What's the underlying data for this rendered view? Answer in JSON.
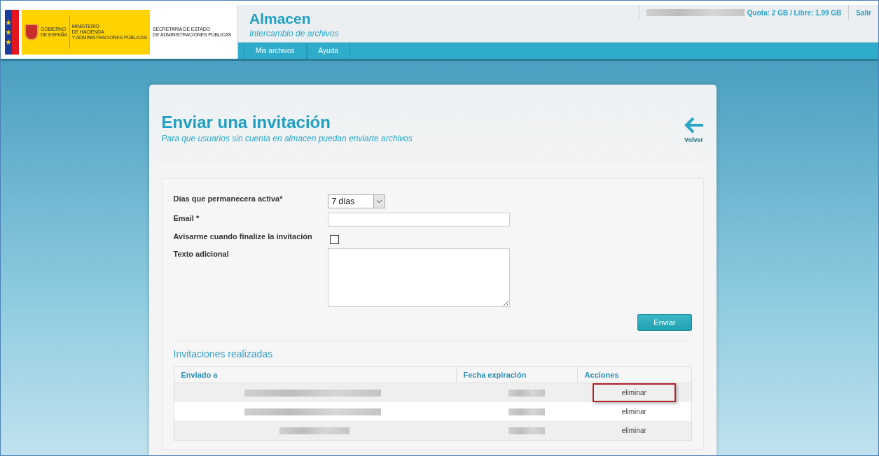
{
  "logo": {
    "lines_left": [
      "GOBIERNO",
      "DE ESPAÑA"
    ],
    "lines_mid": [
      "MINISTERIO",
      "DE HACIENDA",
      "Y ADMINISTRACIONES PÚBLICAS"
    ],
    "lines_right": [
      "SECRETARÍA DE ESTADO",
      "DE ADMINISTRACIONES PÚBLICAS"
    ]
  },
  "app": {
    "title": "Almacen",
    "subtitle": "Intercambio de archivos"
  },
  "user_bar": {
    "quota": "Quota: 2 GB / Libre: 1.99 GB",
    "logout": "Salir"
  },
  "nav": [
    {
      "label": "Mis archivos",
      "selected": false
    },
    {
      "label": "Ayuda",
      "selected": false
    }
  ],
  "page": {
    "title": "Enviar una invitación",
    "subtitle": "Para que usuarios sin cuenta en almacen puedan enviarte archivos",
    "back": "Volver"
  },
  "form": {
    "days_label": "Días que permanecera activa*",
    "days_value": "7 días",
    "email_label": "Email *",
    "notify_label": "Avisarme cuando finalize la invitación",
    "notify_checked": false,
    "text_label": "Texto adicional",
    "submit": "Enviar"
  },
  "invitations": {
    "title": "Invitaciones realizadas",
    "columns": [
      "Enviado a",
      "Fecha expiración",
      "Acciones"
    ],
    "rows": [
      {
        "action": "eliminar",
        "highlighted": true
      },
      {
        "action": "eliminar",
        "highlighted": false
      },
      {
        "action": "eliminar",
        "highlighted": false
      }
    ]
  }
}
